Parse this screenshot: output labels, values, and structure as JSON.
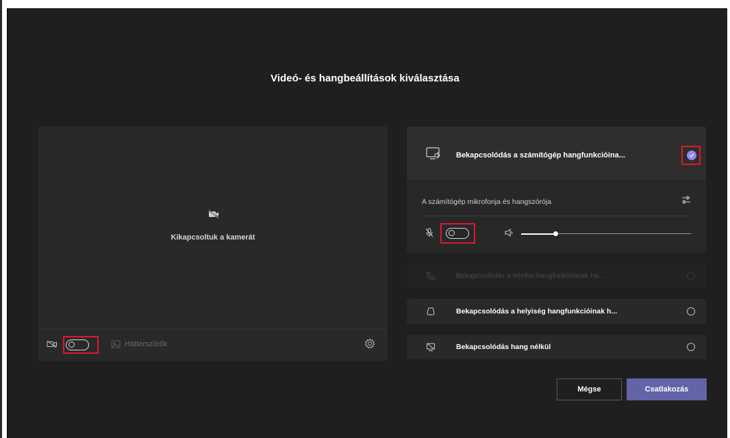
{
  "dialog": {
    "title": "Videó- és hangbeállítások kiválasztása"
  },
  "preview": {
    "camera_off_text": "Kikapcsoltuk a kamerát",
    "background_filters_label": "Háttérszűrők",
    "camera_toggle": "off"
  },
  "audio": {
    "computer_audio_label": "Bekapcsolódás a számítógép hangfunkcióina...",
    "computer_audio_selected": true,
    "mic_speaker_label": "A számítógép mikrofonja és hangszórója",
    "mic_toggle": "off",
    "speaker_volume": 0.2,
    "phone_audio_label": "Bekapcsolódás a telefon hangfunkcióinak ha...",
    "room_audio_label": "Bekapcsolódás a helyiség hangfunkcióinak h...",
    "no_audio_label": "Bekapcsolódás hang nélkül"
  },
  "buttons": {
    "cancel": "Mégse",
    "join": "Csatlakozás"
  },
  "colors": {
    "background": "#201f1f",
    "accent": "#6264a7",
    "highlight": "#e0182b",
    "check": "#8b8bf0"
  }
}
